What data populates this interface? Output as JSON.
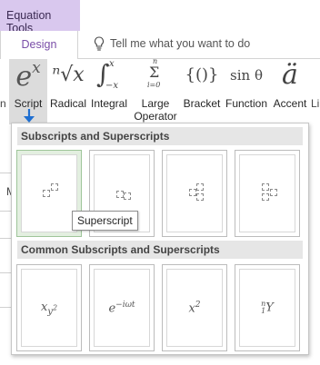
{
  "context_tab": {
    "label": "Equation Tools"
  },
  "tabs": {
    "design": "Design"
  },
  "tell_me": {
    "placeholder": "Tell me what you want to do"
  },
  "ribbon": {
    "edge_label": "n",
    "edge_label_right": "Li",
    "script": {
      "label": "Script"
    },
    "radical": {
      "label": "Radical",
      "glyph": "ⁿ√x"
    },
    "integral": {
      "label": "Integral",
      "glyph": "∫",
      "upper": "x",
      "lower": "−x"
    },
    "large_operator": {
      "label1": "Large",
      "label2": "Operator",
      "glyph": "Σ",
      "upper": "n",
      "lower": "i=0"
    },
    "bracket": {
      "label": "Bracket",
      "glyph": "{()}"
    },
    "function": {
      "label": "Function",
      "glyph": "sin θ"
    },
    "accent": {
      "label": "Accent",
      "glyph": "ä"
    }
  },
  "gallery": {
    "section1_title": "Subscripts and Superscripts",
    "section2_title": "Common Subscripts and Superscripts",
    "tooltip": "Superscript",
    "common": [
      {
        "text": "x",
        "sub": "y",
        "sup": "2"
      },
      {
        "text": "e",
        "sup": "−iωt"
      },
      {
        "text": "x",
        "sup": "2"
      },
      {
        "pre_sup": "n",
        "pre_sub": "1",
        "text": "Y"
      }
    ]
  },
  "left_edge_letter": "M",
  "colors": {
    "context_tab_bg": "#d9c8ee",
    "accent": "#7a4ea8",
    "selected_tile": "#e3efe0",
    "arrow": "#1f6fd1"
  }
}
